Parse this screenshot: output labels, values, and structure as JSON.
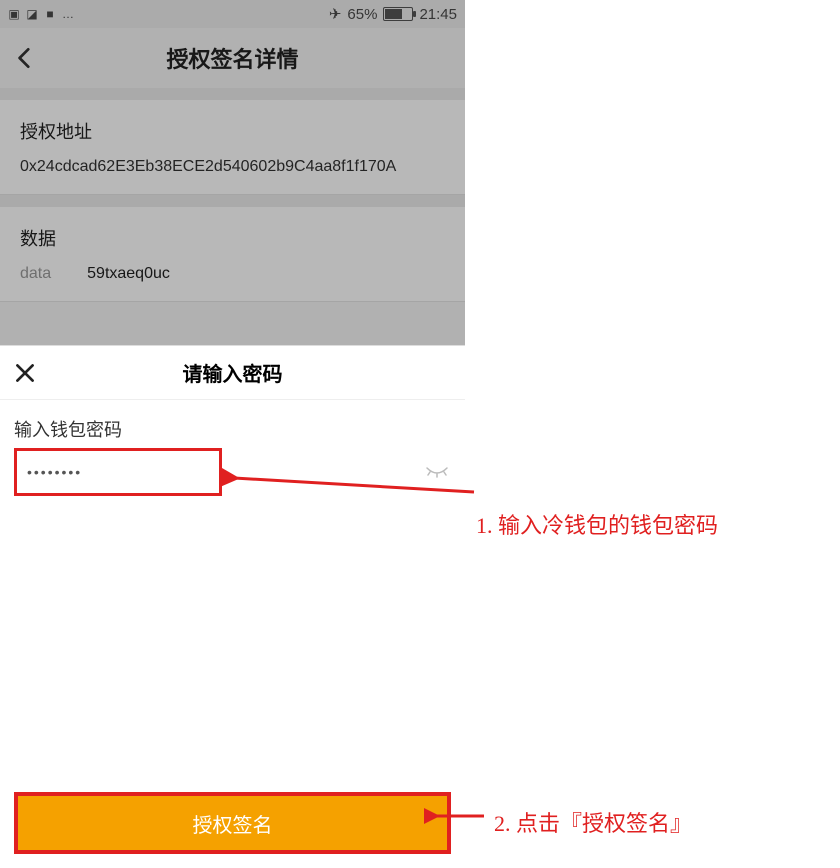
{
  "status": {
    "icons": [
      "▣",
      "◪",
      "■",
      "…"
    ],
    "airplane_icon": "✈",
    "battery_text": "65%",
    "time": "21:45"
  },
  "nav": {
    "title": "授权签名详情"
  },
  "auth_section": {
    "title": "授权地址",
    "value": "0x24cdcad62E3Eb38ECE2d540602b9C4aa8f1f170A"
  },
  "data_section": {
    "title": "数据",
    "key": "data",
    "value": "59txaeq0uc"
  },
  "sheet": {
    "title": "请输入密码",
    "field_label": "输入钱包密码",
    "password_mask": "••••••••",
    "button_label": "授权签名"
  },
  "annotations": {
    "step1": "1. 输入冷钱包的钱包密码",
    "step2": "2. 点击『授权签名』"
  }
}
